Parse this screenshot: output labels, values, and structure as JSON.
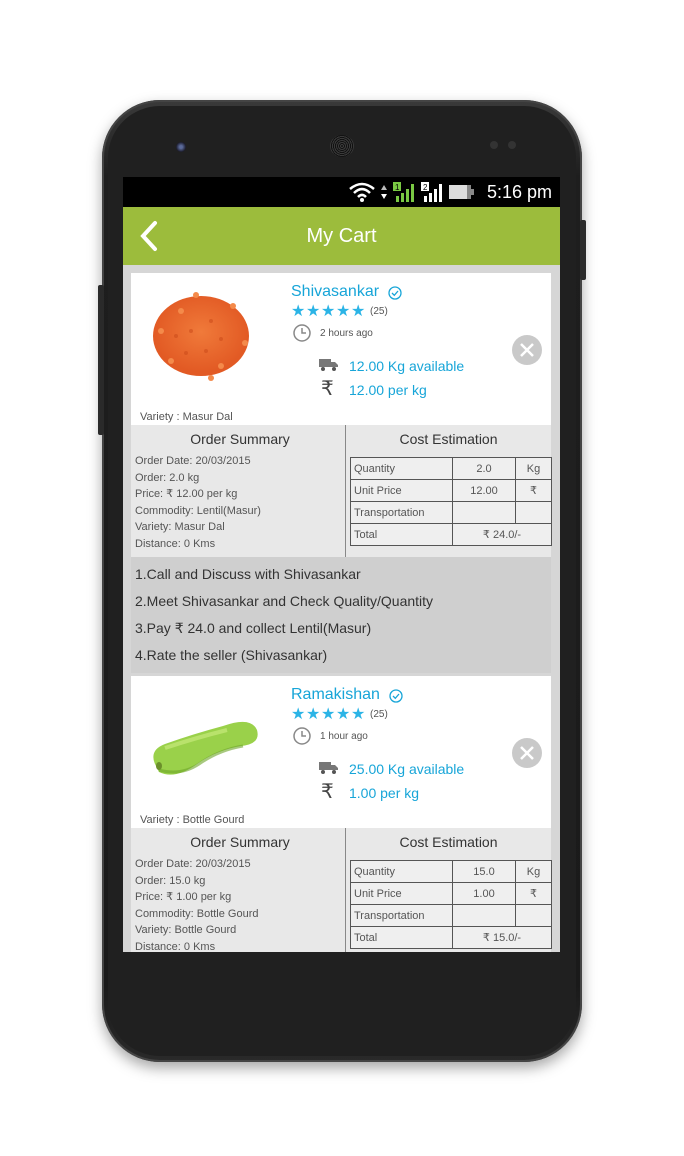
{
  "status_bar": {
    "time": "5:16 pm"
  },
  "app_bar": {
    "title": "My Cart"
  },
  "cart_items": [
    {
      "seller": "Shivasankar",
      "rating_count": "(25)",
      "time_ago": "2 hours ago",
      "availability": "12.00 Kg available",
      "price": "12.00 per kg",
      "variety_label": "Variety : Masur Dal",
      "order_summary_title": "Order Summary",
      "cost_estimation_title": "Cost Estimation",
      "details": [
        "Order Date: 20/03/2015",
        "Order: 2.0 kg",
        "Price: ₹ 12.00 per kg",
        "Commodity: Lentil(Masur)",
        "Variety: Masur Dal",
        "Distance: 0 Kms"
      ],
      "cost": {
        "quantity_label": "Quantity",
        "quantity": "2.0",
        "quantity_unit": "Kg",
        "unit_price_label": "Unit Price",
        "unit_price": "12.00",
        "unit_price_unit": "₹",
        "transport_label": "Transportation",
        "transport": "",
        "transport_unit": "",
        "total_label": "Total",
        "total": "₹ 24.0/-"
      },
      "steps": [
        "1.Call and Discuss with Shivasankar",
        "2.Meet Shivasankar and Check Quality/Quantity",
        "3.Pay ₹ 24.0 and collect Lentil(Masur)",
        "4.Rate the seller (Shivasankar)"
      ]
    },
    {
      "seller": "Ramakishan",
      "rating_count": "(25)",
      "time_ago": "1 hour ago",
      "availability": "25.00 Kg available",
      "price": "1.00 per kg",
      "variety_label": "Variety : Bottle Gourd",
      "order_summary_title": "Order Summary",
      "cost_estimation_title": "Cost Estimation",
      "details": [
        "Order Date: 20/03/2015",
        "Order: 15.0 kg",
        "Price: ₹ 1.00 per kg",
        "Commodity: Bottle Gourd",
        "Variety: Bottle Gourd",
        "Distance: 0 Kms"
      ],
      "cost": {
        "quantity_label": "Quantity",
        "quantity": "15.0",
        "quantity_unit": "Kg",
        "unit_price_label": "Unit Price",
        "unit_price": "1.00",
        "unit_price_unit": "₹",
        "transport_label": "Transportation",
        "transport": "",
        "transport_unit": "",
        "total_label": "Total",
        "total": "₹ 15.0/-"
      }
    }
  ],
  "icons": {
    "rupee": "₹",
    "colors": {
      "accent": "#9cbc3c",
      "link": "#17a5d8",
      "star": "#2bb4e6"
    }
  }
}
